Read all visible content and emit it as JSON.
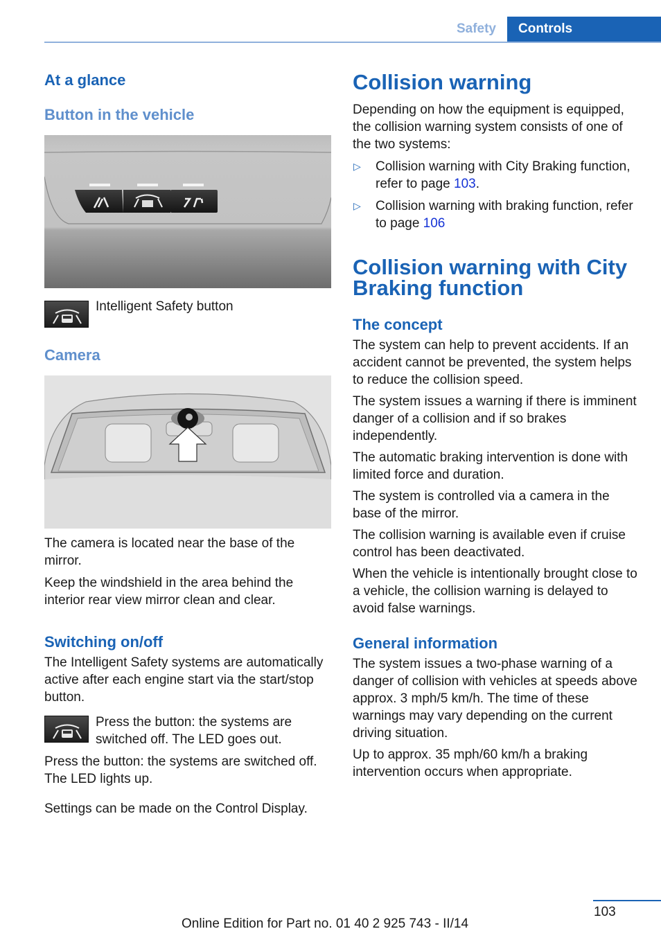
{
  "header": {
    "section_tab": "Safety",
    "chapter_tab": "Controls"
  },
  "left": {
    "at_a_glance": "At a glance",
    "button_heading": "Button in the vehicle",
    "button_figure_icon": "console-buttons-image",
    "intelligent_safety_caption": "Intelligent Safety button",
    "camera_heading": "Camera",
    "camera_figure_icon": "windshield-camera-image",
    "camera_text_1": "The camera is located near the base of the mirror.",
    "camera_text_2": "Keep the windshield in the area behind the interior rear view mirror clean and clear.",
    "switching_heading": "Switching on/off",
    "switching_text": "The Intelligent Safety systems are automatically active after each engine start via the start/stop button.",
    "press_off_text": "Press the button: the systems are switched off. The LED goes out.",
    "press_on_text": "Press the button: the systems are switched off. The LED lights up.",
    "settings_text": "Settings can be made on the Control Display."
  },
  "right": {
    "collision_heading": "Collision warning",
    "intro": "Depending on how the equipment is equipped, the collision warning system consists of one of the two systems:",
    "bullets": [
      {
        "text": "Collision warning with City Braking function, refer to page ",
        "page": "103",
        "suffix": "."
      },
      {
        "text": "Collision warning with braking function, refer to page ",
        "page": "106",
        "suffix": ""
      }
    ],
    "city_heading": "Collision warning with City Braking function",
    "concept_heading": "The concept",
    "concept_paragraphs": [
      "The system can help to prevent accidents. If an accident cannot be prevented, the system helps to reduce the collision speed.",
      "The system issues a warning if there is imminent danger of a collision and if so brakes independently.",
      "The automatic braking intervention is done with limited force and duration.",
      "The system is controlled via a camera in the base of the mirror.",
      "The collision warning is available even if cruise control has been deactivated.",
      "When the vehicle is intentionally brought close to a vehicle, the collision warning is delayed to avoid false warnings."
    ],
    "general_heading": "General information",
    "general_paragraphs": [
      "The system issues a two-phase warning of a danger of collision with vehicles at speeds above approx. 3 mph/5 km/h. The time of these warnings may vary depending on the current driving situation.",
      "Up to approx. 35 mph/60 km/h a braking intervention occurs when appropriate."
    ]
  },
  "footer": {
    "page_number": "103",
    "edition": "Online Edition for Part no. 01 40 2 925 743 - II/14"
  }
}
